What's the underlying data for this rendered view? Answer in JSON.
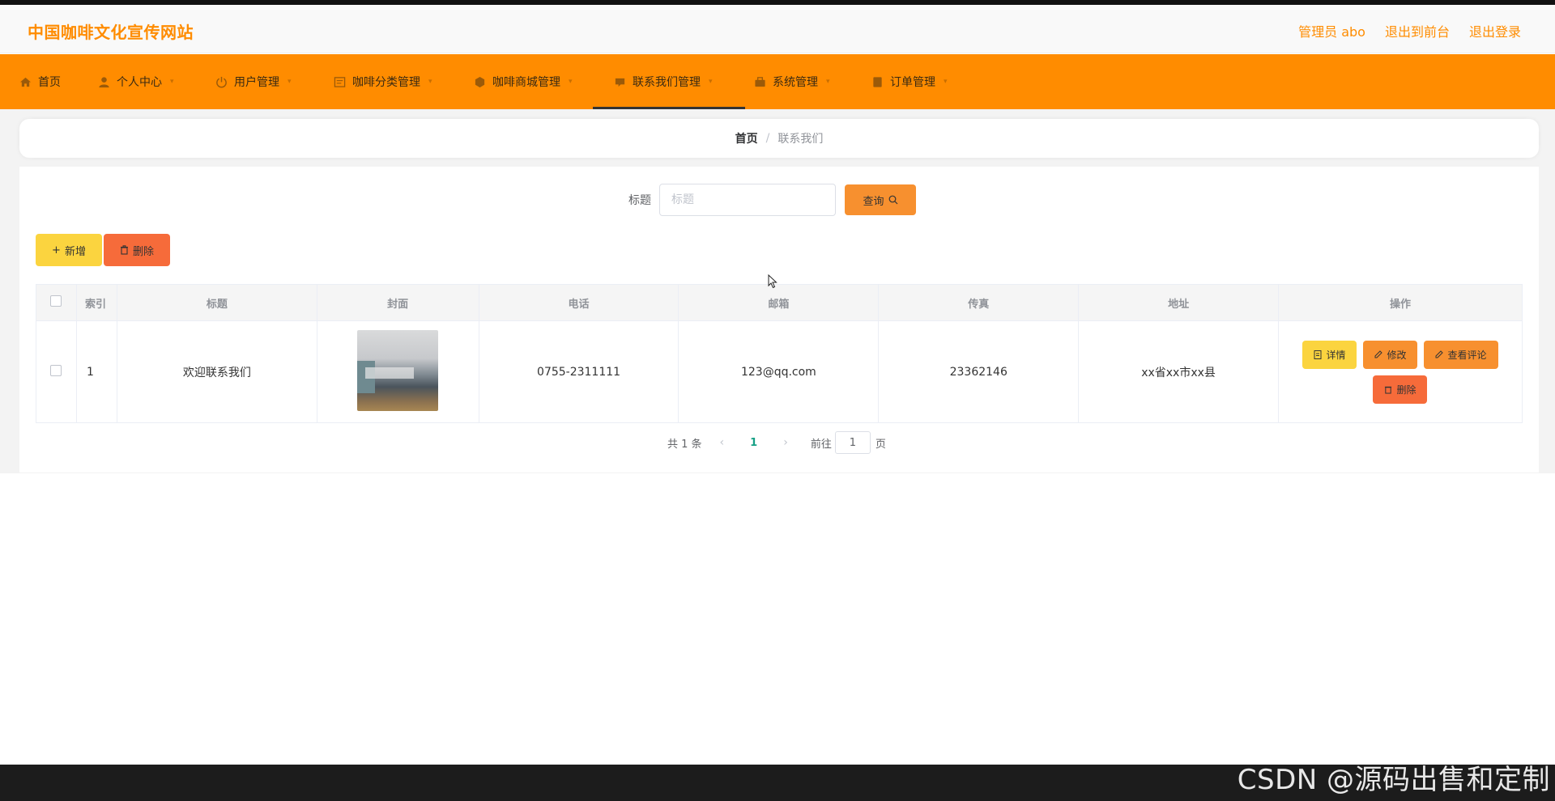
{
  "header": {
    "title": "中国咖啡文化宣传网站",
    "links": [
      "管理员 abo",
      "退出到前台",
      "退出登录"
    ]
  },
  "nav": {
    "items": [
      {
        "label": "首页",
        "icon": "home-icon"
      },
      {
        "label": "个人中心",
        "icon": "user-icon"
      },
      {
        "label": "用户管理",
        "icon": "power-icon"
      },
      {
        "label": "咖啡分类管理",
        "icon": "category-icon"
      },
      {
        "label": "咖啡商城管理",
        "icon": "shop-icon"
      },
      {
        "label": "联系我们管理",
        "icon": "contact-icon"
      },
      {
        "label": "系统管理",
        "icon": "system-icon"
      },
      {
        "label": "订单管理",
        "icon": "order-icon"
      }
    ],
    "active_index": 5
  },
  "breadcrumb": {
    "home": "首页",
    "separator": "/",
    "current": "联系我们"
  },
  "search": {
    "label": "标题",
    "placeholder": "标题",
    "query_button": "查询"
  },
  "actions": {
    "add": "新增",
    "delete": "删除"
  },
  "table": {
    "headers": [
      "索引",
      "标题",
      "封面",
      "电话",
      "邮箱",
      "传真",
      "地址",
      "操作"
    ],
    "rows": [
      {
        "index": "1",
        "title": "欢迎联系我们",
        "phone": "0755-2311111",
        "email": "123@qq.com",
        "fax": "23362146",
        "address": "xx省xx市xx县",
        "ops": [
          "详情",
          "修改",
          "查看评论",
          "删除"
        ]
      }
    ]
  },
  "pager": {
    "total": "共 1 条",
    "page": "1",
    "goto_label": "前往",
    "goto_value": "1",
    "page_unit": "页"
  },
  "watermark": "CSDN @源码出售和定制",
  "colors": {
    "accent": "#ff8c00",
    "yellow": "#fbd43f",
    "orange": "#f7902f",
    "red": "#f66b3a"
  }
}
